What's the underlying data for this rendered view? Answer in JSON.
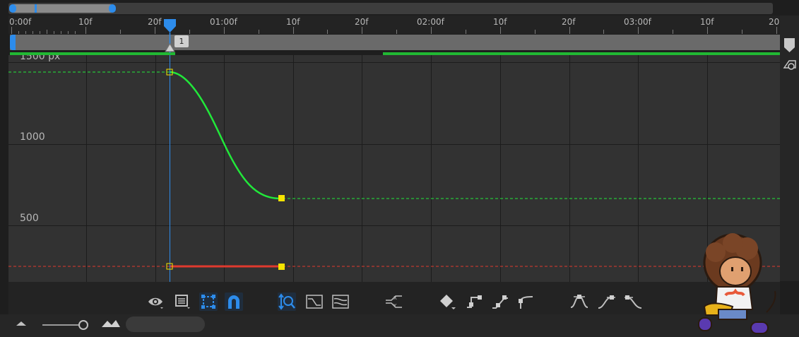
{
  "ruler": {
    "ticks": [
      "0:00f",
      "10f",
      "20f",
      "01:00f",
      "10f",
      "20f",
      "02:00f",
      "10f",
      "20f",
      "03:00f",
      "10f",
      "20"
    ]
  },
  "marker": {
    "label": "1"
  },
  "graph": {
    "y_labels": {
      "top": "1500 px",
      "mid": "1000",
      "low": "500"
    }
  },
  "colors": {
    "accent": "#2d8ceb",
    "curve_green": "#21e83a",
    "curve_red": "#e03a2e",
    "keyframe": "#f5e400",
    "work_bar_green": "#21b833"
  },
  "toolbar": {
    "icons": [
      "eye-icon",
      "list-icon",
      "transform-box-icon",
      "snap-magnet-icon",
      "auto-zoom-height-icon",
      "fit-selection-icon",
      "fit-all-icon",
      "separate-dimensions-icon",
      "keyframe-interpolation-icon",
      "convert-hold-icon",
      "convert-linear-icon",
      "convert-auto-bezier-icon",
      "easy-ease-icon",
      "easy-ease-in-icon",
      "easy-ease-out-icon"
    ]
  }
}
